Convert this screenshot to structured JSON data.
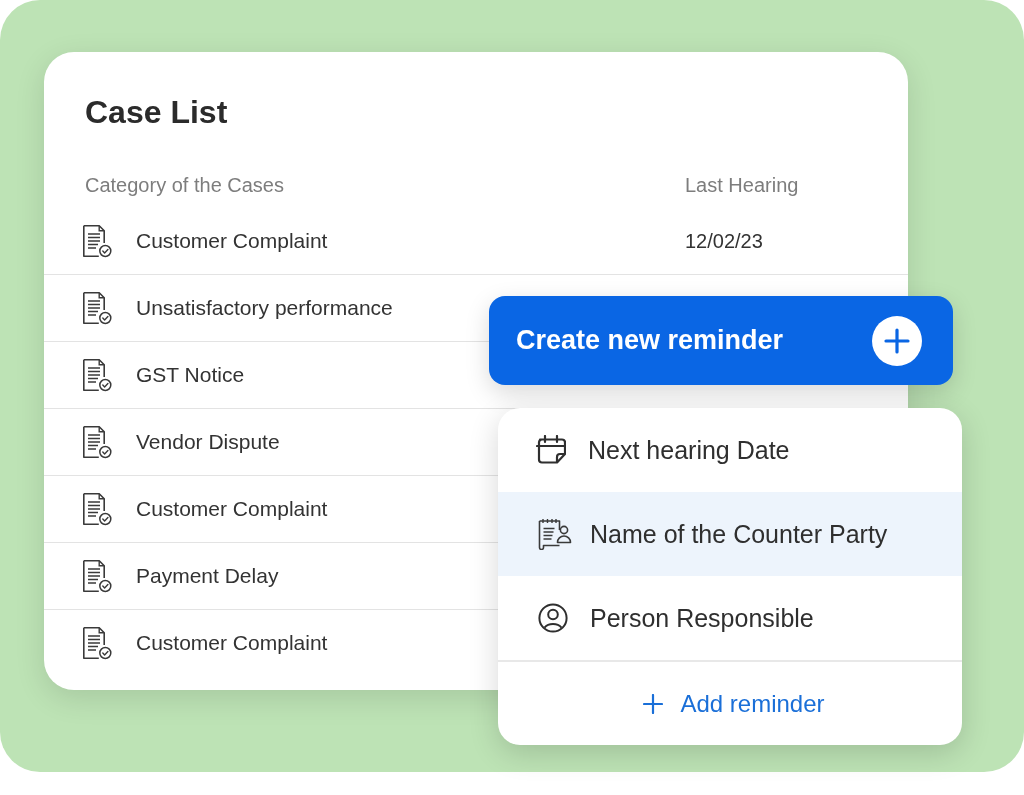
{
  "case_list": {
    "title": "Case List",
    "columns": [
      "Category of the Cases",
      "Last Hearing"
    ],
    "rows": [
      {
        "category": "Customer Complaint",
        "last_hearing": "12/02/23"
      },
      {
        "category": "Unsatisfactory performance"
      },
      {
        "category": "GST Notice"
      },
      {
        "category": "Vendor Dispute"
      },
      {
        "category": "Customer Complaint"
      },
      {
        "category": "Payment Delay"
      },
      {
        "category": "Customer Complaint"
      }
    ]
  },
  "create_button": {
    "label": "Create new reminder"
  },
  "reminder_menu": {
    "items": [
      {
        "kind": "calendar",
        "label": "Next hearing Date",
        "selected": false
      },
      {
        "kind": "counter-party",
        "label": "Name of the Counter Party",
        "selected": true
      },
      {
        "kind": "person",
        "label": "Person Responsible",
        "selected": false
      }
    ],
    "add_button": {
      "label": "Add reminder"
    }
  }
}
